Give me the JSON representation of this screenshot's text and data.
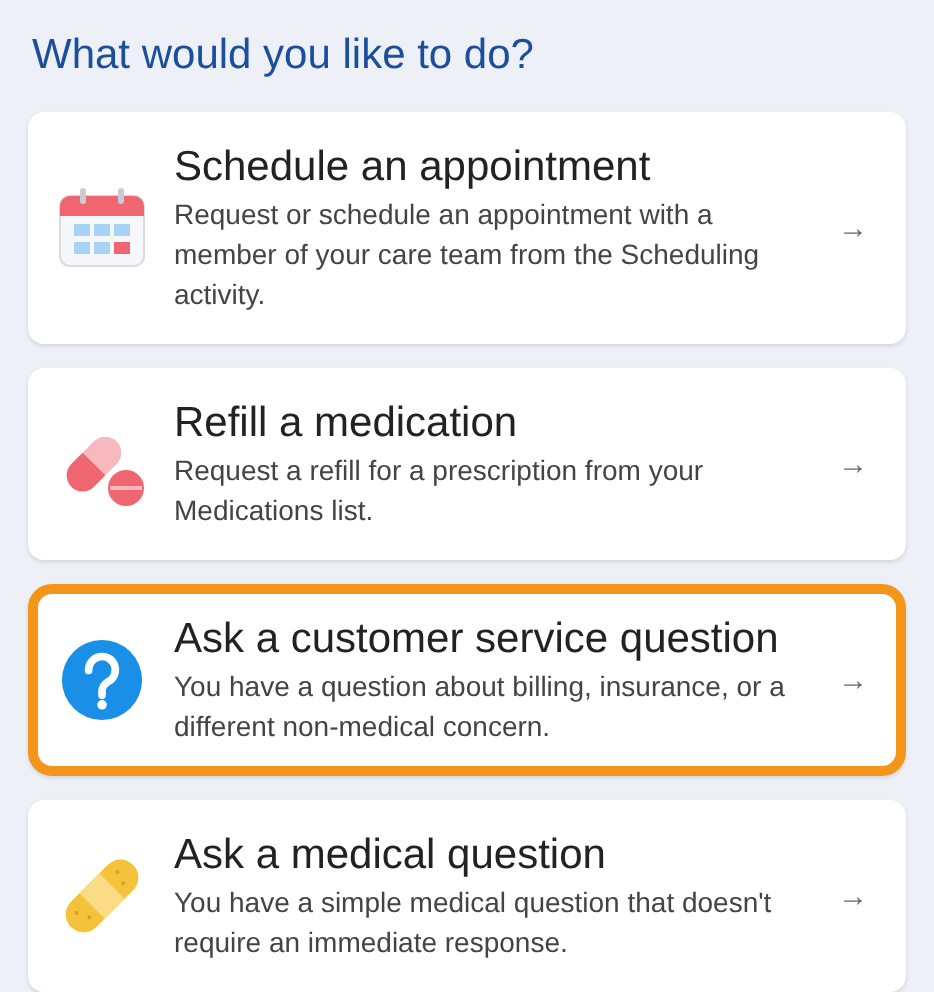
{
  "heading": "What would you like to do?",
  "options": [
    {
      "kind": "calendar",
      "title": "Schedule an appointment",
      "description": "Request or schedule an appointment with a member of your care team from the Scheduling activity.",
      "arrow": "→",
      "selected": false
    },
    {
      "kind": "pill",
      "title": "Refill a medication",
      "description": "Request a refill for a prescription from your Medications list.",
      "arrow": "→",
      "selected": false
    },
    {
      "kind": "question",
      "title": "Ask a customer service question",
      "description": "You have a question about billing, insurance, or a different non-medical concern.",
      "arrow": "→",
      "selected": true
    },
    {
      "kind": "bandage",
      "title": "Ask a medical question",
      "description": "You have a simple medical question that doesn't require an immediate response.",
      "arrow": "→",
      "selected": false
    }
  ]
}
